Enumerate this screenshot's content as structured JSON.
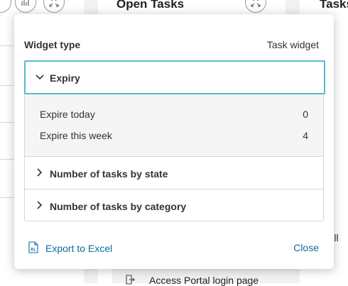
{
  "background": {
    "mid_title": "Open Tasks",
    "right_title": "Tasks",
    "right_partial_text": "r all",
    "bottom_row_text": "Access Portal login page"
  },
  "modal": {
    "header_label": "Widget type",
    "header_value": "Task widget",
    "sections": [
      {
        "title": "Expiry",
        "expanded": true,
        "rows": [
          {
            "label": "Expire today",
            "value": "0"
          },
          {
            "label": "Expire this week",
            "value": "4"
          }
        ]
      },
      {
        "title": "Number of tasks by state",
        "expanded": false
      },
      {
        "title": "Number of tasks by category",
        "expanded": false
      }
    ],
    "export_label": "Export to Excel",
    "close_label": "Close"
  },
  "colors": {
    "accent": "#0a6e9c",
    "focus_border": "#5bb8cf"
  }
}
